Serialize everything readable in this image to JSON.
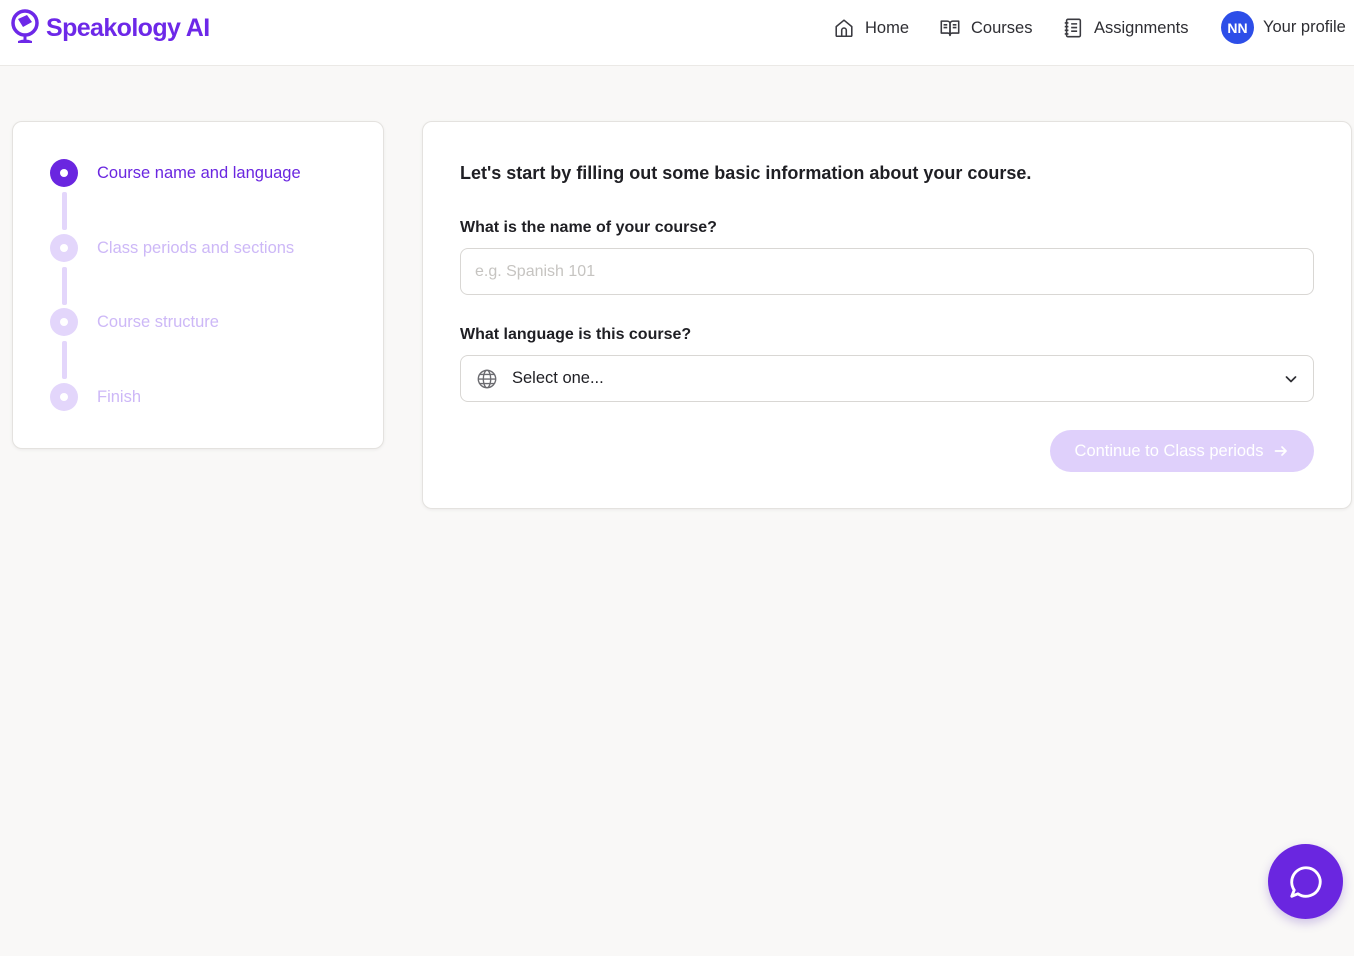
{
  "brand": {
    "name": "Speakology AI",
    "color": "#6d28e8",
    "logo_icon": "speakology-logo-icon"
  },
  "nav": {
    "home": {
      "label": "Home",
      "icon": "home-icon"
    },
    "courses": {
      "label": "Courses",
      "icon": "book-open-icon"
    },
    "assignments": {
      "label": "Assignments",
      "icon": "notebook-icon"
    },
    "profile": {
      "label": "Your profile",
      "avatar_initials": "NN",
      "avatar_color": "#2d4ee8"
    }
  },
  "stepper": {
    "active_color": "#6a26e0",
    "inactive_color": "#cdb8f7",
    "steps": [
      {
        "label": "Course name and language",
        "state": "active"
      },
      {
        "label": "Class periods and sections",
        "state": "upcoming"
      },
      {
        "label": "Course structure",
        "state": "upcoming"
      },
      {
        "label": "Finish",
        "state": "upcoming"
      }
    ]
  },
  "form": {
    "intro": "Let's start by filling out some basic information about your course.",
    "course_name": {
      "label": "What is the name of your course?",
      "placeholder": "e.g. Spanish 101",
      "value": ""
    },
    "language": {
      "label": "What language is this course?",
      "value": "Select one...",
      "icon": "globe-icon"
    },
    "continue_button": {
      "label": "Continue to Class periods",
      "state": "disabled",
      "color": "#dfd0fb"
    }
  },
  "chat": {
    "icon": "chat-bubble-icon",
    "color": "#6a26e0"
  }
}
